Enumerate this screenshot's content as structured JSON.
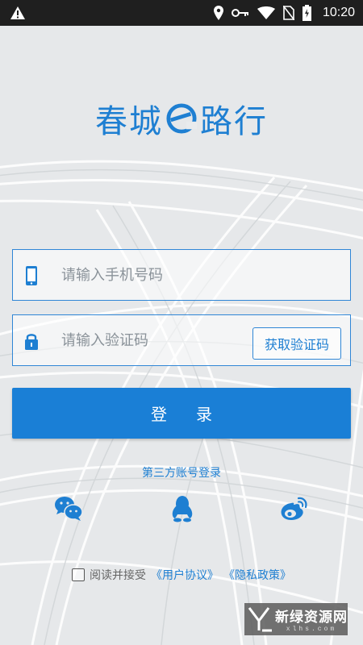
{
  "status_bar": {
    "time": "10:20",
    "icons": [
      "warning-icon",
      "location-icon",
      "key-icon",
      "wifi-icon",
      "no-sim-icon",
      "battery-charging-icon"
    ]
  },
  "logo": {
    "left": "春城",
    "right": "路行",
    "mark": "e-letter-logo-icon"
  },
  "phone_field": {
    "placeholder": "请输入手机号码",
    "value": "",
    "icon": "phone-icon"
  },
  "code_field": {
    "placeholder": "请输入验证码",
    "value": "",
    "icon": "lock-icon",
    "get_code_label": "获取验证码"
  },
  "login_button": {
    "label": "登录"
  },
  "third_party": {
    "title": "第三方账号登录",
    "icons": [
      "wechat-icon",
      "qq-icon",
      "weibo-icon"
    ]
  },
  "agreement": {
    "text": "阅读并接受",
    "user_agreement": "《用户协议》",
    "privacy_policy": "《隐私政策》",
    "checked": false
  },
  "colors": {
    "accent": "#1a7fd6",
    "background": "#e9ebed",
    "status_bar": "#1f1f1f"
  },
  "watermark": {
    "main": "新绿资源网",
    "sub": "xlhs.com"
  }
}
